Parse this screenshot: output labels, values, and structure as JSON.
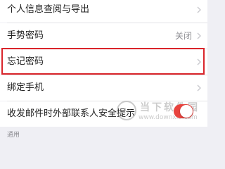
{
  "settings": {
    "rows": [
      {
        "label": "个人信息查阅与导出",
        "value": ""
      },
      {
        "label": "手势密码",
        "value": "关闭"
      },
      {
        "label": "忘记密码",
        "value": ""
      },
      {
        "label": "绑定手机",
        "value": ""
      },
      {
        "label": "收发邮件时外部联系人安全提示",
        "value": ""
      }
    ],
    "external_contact_warning_enabled": true,
    "section_caption": "通用"
  },
  "watermark": {
    "brand": "当下软件园",
    "url": "www.downxia.com"
  },
  "colors": {
    "highlight": "#d9252b",
    "toggle_on": "#e8433e",
    "background": "#efeff4"
  }
}
